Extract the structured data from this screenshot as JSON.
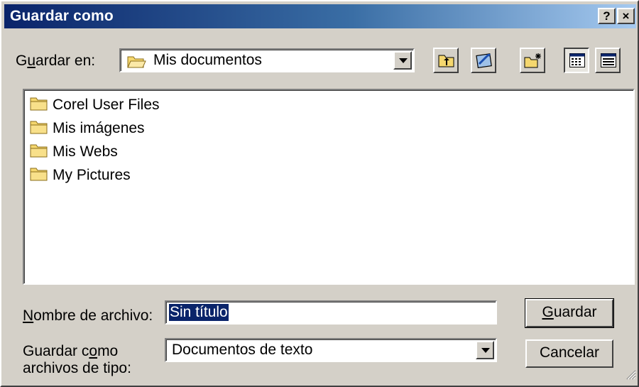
{
  "window": {
    "title": "Guardar como",
    "help_label": "?",
    "close_label": "×"
  },
  "location": {
    "label_pre": "G",
    "label_accel": "u",
    "label_post": "ardar en:",
    "value": "Mis documentos"
  },
  "toolbar": {
    "up_icon": "up-folder-icon",
    "desktop_icon": "desktop-icon",
    "new_folder_icon": "new-folder-icon",
    "list_view_icon": "list-view-icon",
    "details_view_icon": "details-view-icon"
  },
  "files": [
    {
      "name": "Corel User Files"
    },
    {
      "name": "Mis imágenes"
    },
    {
      "name": "Mis Webs"
    },
    {
      "name": "My Pictures"
    }
  ],
  "filename": {
    "label_accel": "N",
    "label_post": "ombre de archivo:",
    "value": "Sin título"
  },
  "filetype": {
    "label_line1_pre": "Guardar c",
    "label_line1_accel": "o",
    "label_line1_post": "mo",
    "label_line2": "archivos de tipo:",
    "value": "Documentos de texto"
  },
  "buttons": {
    "save_accel": "G",
    "save_post": "uardar",
    "cancel": "Cancelar"
  },
  "colors": {
    "title_start": "#0a246a",
    "title_end": "#a6caf0",
    "face": "#d4d0c8",
    "folder": "#f5d76e",
    "selection": "#0a246a"
  }
}
